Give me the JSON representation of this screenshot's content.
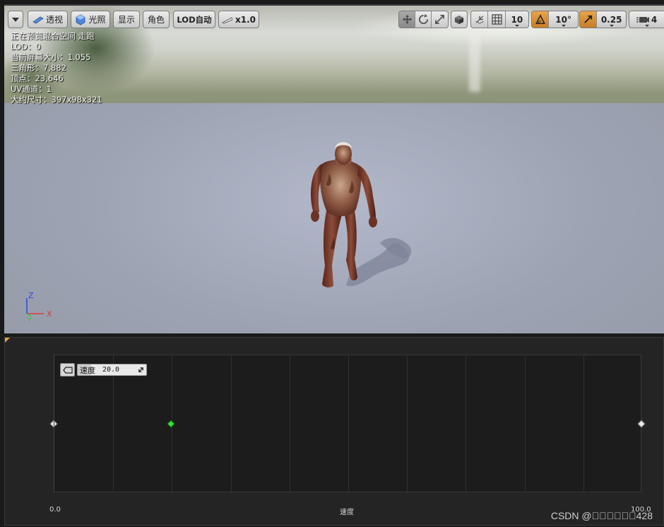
{
  "viewport": {
    "toolbar": {
      "perspective_label": "透视",
      "lit_label": "光照",
      "show_label": "显示",
      "character_label": "角色",
      "lod_label": "LOD自动",
      "speed_label": "x1.0",
      "grid_snap_value": "10",
      "rotation_snap_value": "10°",
      "scale_snap_value": "0.25",
      "camera_speed_value": "4",
      "icons": [
        "menu-dropdown-icon",
        "perspective-icon",
        "lit-sphere-icon",
        "play-speed-icon",
        "translate-icon",
        "rotate-icon",
        "scale-icon",
        "local-space-cube-icon",
        "surface-snap-icon",
        "grid-snap-icon",
        "rotation-snap-icon",
        "scale-snap-icon",
        "camera-speed-icon"
      ],
      "accent_color": "#d68a2f"
    },
    "stats": [
      "正在预览混合空间 走跑",
      "LOD：0",
      "当前屏幕大小：1.055",
      "三角形：7,882",
      "顶点：23,646",
      "UV通道：1",
      "大约尺寸：397x98x321"
    ],
    "axis_gizmo": {
      "z": "Z",
      "x": "X",
      "y": "Y"
    }
  },
  "blend_space": {
    "axis_name": "速度",
    "x_min": "0.0",
    "x_max": "100.0",
    "range": [
      0,
      100
    ],
    "samples": [
      {
        "value": 0,
        "active": false
      },
      {
        "value": 20,
        "active": true
      },
      {
        "value": 100,
        "active": false
      }
    ],
    "grid_divisions": 10,
    "tooltip": {
      "label": "速度",
      "value": "20.0"
    }
  },
  "watermark": "CSDN @\u0000\u0000\u0000\u0000\u0000\u0000428"
}
